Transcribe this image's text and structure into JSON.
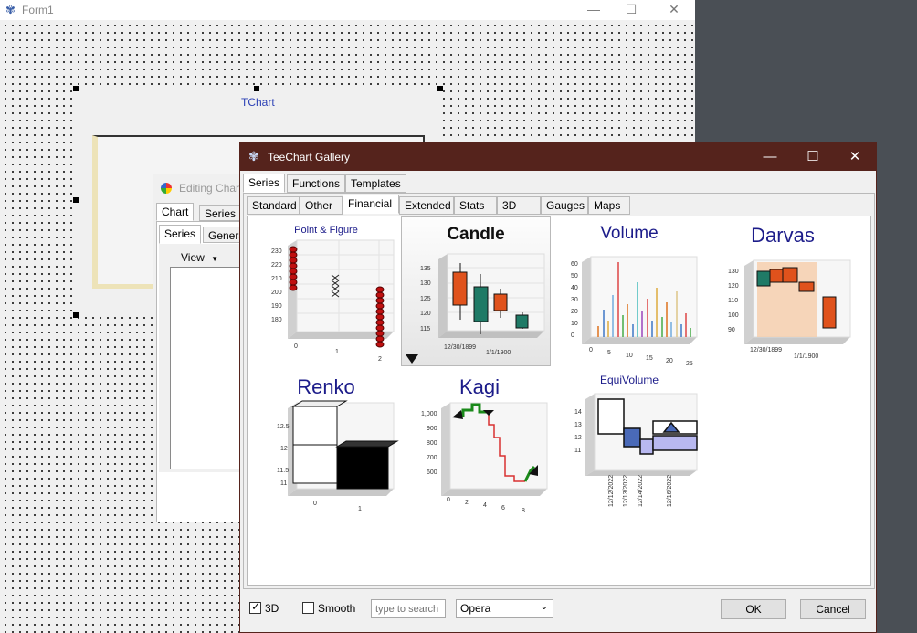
{
  "form1": {
    "title": "Form1",
    "chart_label": "TChart"
  },
  "editing": {
    "title": "Editing Char",
    "tab1": "Chart",
    "tab2": "Series",
    "subtab1": "Series",
    "subtab2": "Genera",
    "view_label": "View"
  },
  "gallery": {
    "title": "TeeChart Gallery",
    "main_tabs": [
      "Series",
      "Functions",
      "Templates"
    ],
    "sub_tabs": [
      "Standard",
      "Other",
      "Financial",
      "Extended",
      "Stats",
      "3D",
      "Gauges",
      "Maps"
    ],
    "selected_sub_tab": "Financial",
    "items": [
      {
        "title": "Point & Figure",
        "selected": false
      },
      {
        "title": "Candle",
        "selected": true
      },
      {
        "title": "Volume",
        "selected": false
      },
      {
        "title": "Darvas",
        "selected": false
      },
      {
        "title": "Renko",
        "selected": false
      },
      {
        "title": "Kagi",
        "selected": false
      },
      {
        "title": "EquiVolume",
        "selected": false
      }
    ],
    "thumb_labels": {
      "pf_y": [
        "230",
        "220",
        "210",
        "200",
        "190",
        "180"
      ],
      "pf_x": [
        "0",
        "1",
        "2"
      ],
      "candle_y": [
        "135",
        "130",
        "125",
        "120",
        "115"
      ],
      "candle_x": [
        "12/30/1899",
        "1/1/1900"
      ],
      "volume_y": [
        "60",
        "50",
        "40",
        "30",
        "20",
        "10",
        "0"
      ],
      "volume_x": [
        "0",
        "5",
        "10",
        "15",
        "20",
        "25"
      ],
      "darvas_y": [
        "130",
        "120",
        "110",
        "100",
        "90"
      ],
      "darvas_x": [
        "12/30/1899",
        "1/1/1900"
      ],
      "renko_y": [
        "12.5",
        "12",
        "11.5",
        "11"
      ],
      "renko_x": [
        "0",
        "1"
      ],
      "kagi_y": [
        "1,000",
        "900",
        "800",
        "700",
        "600"
      ],
      "kagi_x": [
        "0",
        "2",
        "4",
        "6",
        "8"
      ],
      "equi_y": [
        "14",
        "13",
        "12",
        "11"
      ],
      "equi_x": [
        "12/12/2022",
        "12/13/2022",
        "12/14/2022",
        "12/16/2022"
      ]
    },
    "options": {
      "cb_3d": {
        "label": "3D",
        "checked": true
      },
      "cb_smooth": {
        "label": "Smooth",
        "checked": false
      },
      "search_placeholder": "type to search",
      "theme_value": "Opera"
    },
    "ok_label": "OK",
    "cancel_label": "Cancel"
  },
  "colors": {
    "gallery_titlebar": "#55231c",
    "candle_up": "#e0521c",
    "candle_down": "#1f7a66"
  }
}
